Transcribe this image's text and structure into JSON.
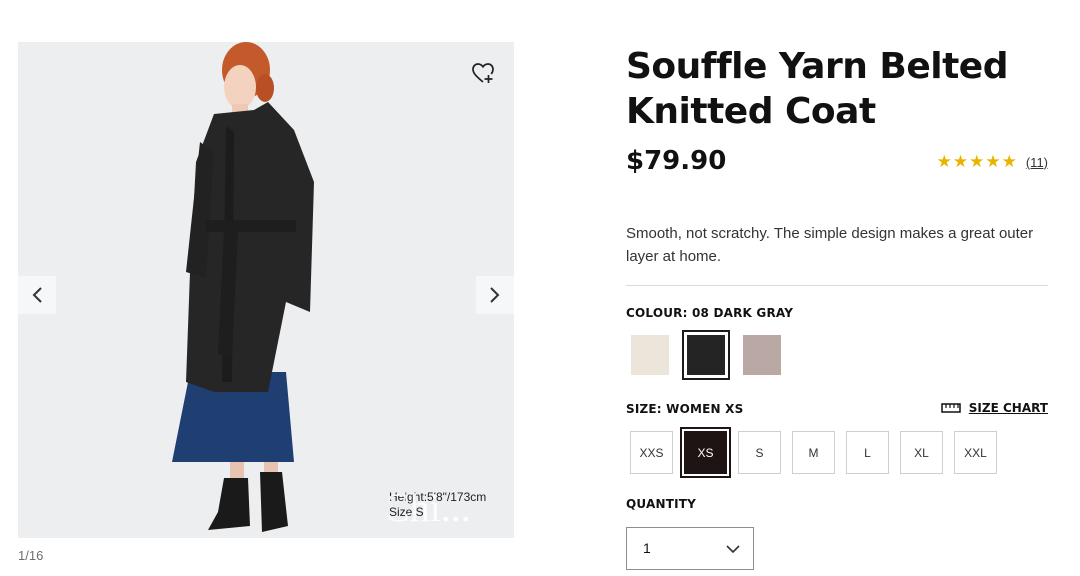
{
  "product": {
    "title": "Souffle Yarn Belted Knitted Coat",
    "price": "$79.90",
    "rating_stars": "★★★★★",
    "rating_value": 4.5,
    "review_count": "(11)",
    "description": "Smooth, not scratchy. The simple design makes a great outer layer at home."
  },
  "gallery": {
    "counter": "1/16",
    "model_height": "Height:5'8\"/173cm",
    "model_size": "Size:S",
    "overlay_text": "Chi..."
  },
  "colour": {
    "label": "COLOUR: 08 DARK GRAY",
    "swatches": [
      {
        "name": "off-white",
        "color": "#ece6da"
      },
      {
        "name": "dark-gray",
        "color": "#242424",
        "selected": true
      },
      {
        "name": "pink-beige",
        "color": "#b9a8a3"
      }
    ]
  },
  "size": {
    "label": "SIZE: WOMEN XS",
    "chart_label": "SIZE CHART",
    "options": [
      "XXS",
      "XS",
      "S",
      "M",
      "L",
      "XL",
      "XXL"
    ],
    "selected": "XS"
  },
  "quantity": {
    "label": "QUANTITY",
    "value": "1"
  },
  "icons": {
    "wishlist": "heart-plus-icon",
    "prev": "chevron-left-icon",
    "next": "chevron-right-icon",
    "ruler": "ruler-icon",
    "dropdown": "chevron-down-icon"
  },
  "colors": {
    "star": "#e9b400",
    "selected_size_bg": "#1f1414",
    "coat": "#262626",
    "skirt": "#1f3f73",
    "top": "#3f73c8"
  }
}
